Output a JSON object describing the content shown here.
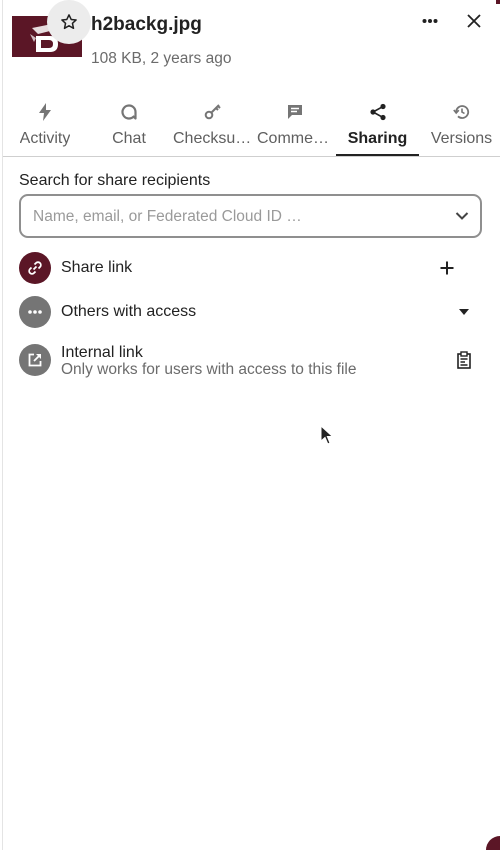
{
  "file": {
    "name": "h2backg.jpg",
    "meta": "108 KB, 2 years ago",
    "thumbnail_color": "#5b1626"
  },
  "header": {
    "favorite_icon": "star-outline-icon",
    "more_icon": "dots-horizontal-icon",
    "close_icon": "close-icon"
  },
  "tabs": [
    {
      "label": "Activity",
      "icon": "lightning-icon"
    },
    {
      "label": "Chat",
      "icon": "chat-bubble-icon"
    },
    {
      "label": "Checksu…",
      "icon": "key-icon"
    },
    {
      "label": "Comme…",
      "icon": "comment-icon"
    },
    {
      "label": "Sharing",
      "icon": "share-icon",
      "active": true
    },
    {
      "label": "Versions",
      "icon": "history-icon"
    }
  ],
  "sharing": {
    "search_label": "Search for share recipients",
    "search_placeholder": "Name, email, or Federated Cloud ID …",
    "share_link": {
      "label": "Share link",
      "icon": "link-icon",
      "action_icon": "plus-icon",
      "color": "#5b1626"
    },
    "others": {
      "label": "Others with access",
      "icon": "dots-horizontal-icon",
      "action_icon": "triangle-down-icon",
      "color": "#757575"
    },
    "internal": {
      "label": "Internal link",
      "sublabel": "Only works for users with access to this file",
      "icon": "open-in-new-icon",
      "action_icon": "clipboard-icon",
      "color": "#757575"
    }
  },
  "colors": {
    "accent": "#5b1626",
    "text": "#222222",
    "muted": "#6b6b6b"
  }
}
